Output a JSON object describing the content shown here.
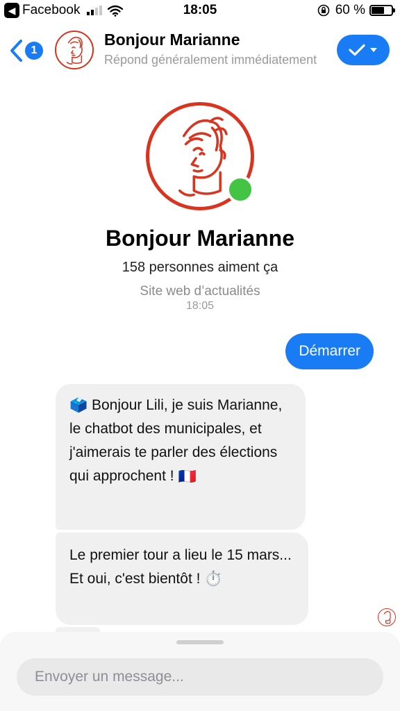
{
  "status_bar": {
    "app_back_label": "Facebook",
    "time": "18:05",
    "battery": "60 %",
    "battery_level": 0.6
  },
  "header": {
    "unread_count": "1",
    "title": "Bonjour Marianne",
    "subtitle": "Répond généralement immédiatement"
  },
  "profile": {
    "name": "Bonjour Marianne",
    "likes": "158 personnes aiment ça",
    "category": "Site web d’actualités"
  },
  "conversation": {
    "timestamp": "18:05",
    "outgoing": [
      {
        "text": "Démarrer"
      }
    ],
    "incoming": [
      {
        "emoji": "🗳️",
        "text": "Bonjour Lili, je suis Marianne, le chatbot des municipales, et j'aimerais te parler des élections qui approchent !",
        "emoji_after": "🇫🇷"
      },
      {
        "text": "Le premier tour a lieu le 15 mars... Et oui, c'est bientôt !",
        "emoji_after": "⏱️"
      }
    ]
  },
  "composer": {
    "placeholder": "Envoyer un message..."
  },
  "colors": {
    "messenger_blue": "#1a7cf5",
    "marianne_red": "#d9341f",
    "online_green": "#43c443",
    "bubble_gray": "#f0f0f0"
  },
  "icons": {
    "back": "chevron-left-icon",
    "action": "checkmark-icon",
    "dropdown": "caret-down-icon",
    "signal": "cellular-signal-icon",
    "wifi": "wifi-icon",
    "rotation_lock": "rotation-lock-icon",
    "battery": "battery-icon"
  }
}
